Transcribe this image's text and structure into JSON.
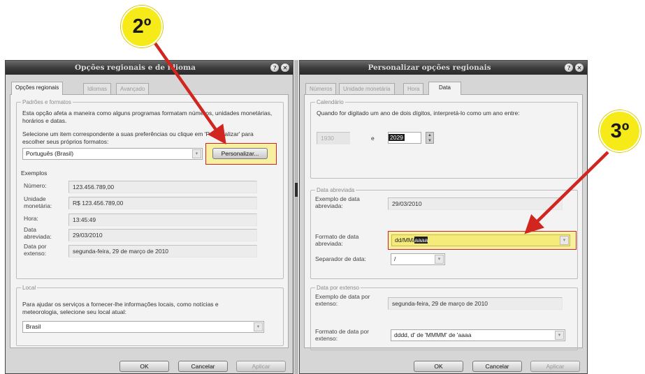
{
  "badges": {
    "step2": "2º",
    "step3": "3º"
  },
  "left_window": {
    "title": "Opções regionais e de idioma",
    "tabs": [
      "Opções regionais",
      "Idiomas",
      "Avançado"
    ],
    "group_formats": {
      "legend": "Padrões e formatos",
      "description": "Esta opção afeta a maneira como alguns programas formatam números, unidades monetárias, horários e datas.",
      "instruction": "Selecione um item correspondente a suas preferências ou clique em 'Personalizar' para escolher seus próprios formatos:",
      "selected_locale": "Português (Brasil)",
      "customize_button": "Personalizar...",
      "examples_label": "Exemplos",
      "examples": [
        {
          "label": "Número:",
          "value": "123.456.789,00"
        },
        {
          "label": "Unidade monetária:",
          "value": "R$ 123.456.789,00"
        },
        {
          "label": "Hora:",
          "value": "13:45:49"
        },
        {
          "label": "Data abreviada:",
          "value": "29/03/2010"
        },
        {
          "label": "Data por extenso:",
          "value": "segunda-feira, 29 de março de 2010"
        }
      ]
    },
    "group_local": {
      "legend": "Local",
      "description": "Para ajudar os serviços a fornecer-lhe informações locais, como notícias e meteorologia, selecione seu local atual:",
      "selected_location": "Brasil"
    },
    "buttons": {
      "ok": "OK",
      "cancel": "Cancelar",
      "apply": "Aplicar"
    }
  },
  "right_window": {
    "title": "Personalizar opções regionais",
    "tabs": [
      "Números",
      "Unidade monetária",
      "Hora",
      "Data"
    ],
    "group_calendar": {
      "legend": "Calendário",
      "description": "Quando for digitado um ano de dois dígitos, interpretá-lo como um ano entre:",
      "year_start": "1930",
      "connector": "e",
      "year_end": "2029"
    },
    "group_short_date": {
      "legend": "Data abreviada",
      "example_label": "Exemplo de data abreviada:",
      "example_value": "29/03/2010",
      "format_label": "Formato de data abreviada:",
      "format_value_prefix": "dd/MM/",
      "format_value_selected": "aaaa",
      "separator_label": "Separador de data:",
      "separator_value": "/"
    },
    "group_long_date": {
      "legend": "Data por extenso",
      "example_label": "Exemplo de data por extenso:",
      "example_value": "segunda-feira, 29 de março de 2010",
      "format_label": "Formato de data por extenso:",
      "format_value": "dddd, d' de 'MMMM' de 'aaaa"
    },
    "buttons": {
      "ok": "OK",
      "cancel": "Cancelar",
      "apply": "Aplicar"
    }
  },
  "colors": {
    "badge": "#f7ea19",
    "arrow": "#d0261f",
    "highlight_fill": "#f7f0a0"
  }
}
